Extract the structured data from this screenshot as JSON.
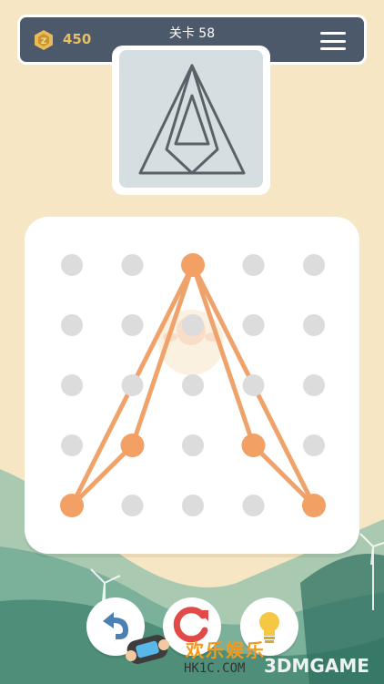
{
  "header": {
    "coin_count": "450",
    "level_label": "关卡 58",
    "coin_icon": "coin-icon",
    "menu_icon": "hamburger-menu-icon"
  },
  "colors": {
    "background": "#f7e6c4",
    "header_bg": "#4c596a",
    "target_bg": "#d5dfe2",
    "line_orange": "#f0a26b",
    "node_orange": "#f2a063",
    "node_gray": "#dcdcdc",
    "target_line": "#5b6168"
  },
  "board": {
    "grid_rows": 5,
    "grid_cols": 5,
    "active_nodes": [
      [
        0,
        2
      ],
      [
        3,
        1
      ],
      [
        3,
        3
      ],
      [
        4,
        0
      ],
      [
        4,
        4
      ]
    ],
    "segments": [
      [
        [
          0,
          2
        ],
        [
          4,
          0
        ]
      ],
      [
        [
          0,
          2
        ],
        [
          4,
          4
        ]
      ],
      [
        [
          4,
          0
        ],
        [
          3,
          1
        ]
      ],
      [
        [
          3,
          1
        ],
        [
          0,
          2
        ]
      ],
      [
        [
          0,
          2
        ],
        [
          3,
          3
        ]
      ],
      [
        [
          3,
          3
        ],
        [
          4,
          4
        ]
      ]
    ]
  },
  "controls": {
    "undo_icon": "undo-arrow-icon",
    "restart_icon": "restart-icon",
    "hint_icon": "lightbulb-icon"
  },
  "watermark": {
    "cn_text": "欢乐娱乐",
    "url_text": "HK1C.COM",
    "brand_text": "3DMGAME"
  }
}
